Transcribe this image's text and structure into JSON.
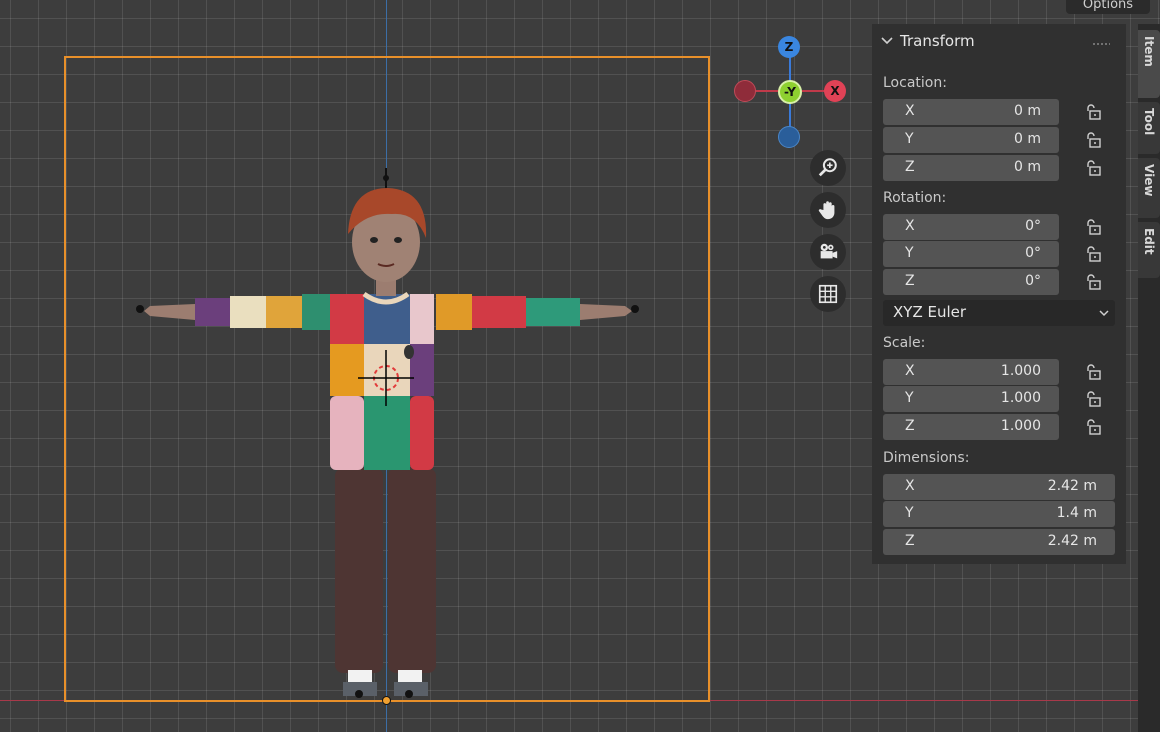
{
  "viewport": {
    "gizmo": {
      "z_label": "Z",
      "y_label": "-Y",
      "x_label": "X"
    }
  },
  "sidebar": {
    "options_label": "Options",
    "panel_title": "Transform",
    "location": {
      "label": "Location:",
      "x": {
        "axis": "X",
        "value": "0 m"
      },
      "y": {
        "axis": "Y",
        "value": "0 m"
      },
      "z": {
        "axis": "Z",
        "value": "0 m"
      }
    },
    "rotation": {
      "label": "Rotation:",
      "x": {
        "axis": "X",
        "value": "0°"
      },
      "y": {
        "axis": "Y",
        "value": "0°"
      },
      "z": {
        "axis": "Z",
        "value": "0°"
      },
      "mode": "XYZ Euler"
    },
    "scale": {
      "label": "Scale:",
      "x": {
        "axis": "X",
        "value": "1.000"
      },
      "y": {
        "axis": "Y",
        "value": "1.000"
      },
      "z": {
        "axis": "Z",
        "value": "1.000"
      }
    },
    "dimensions": {
      "label": "Dimensions:",
      "x": {
        "axis": "X",
        "value": "2.42 m"
      },
      "y": {
        "axis": "Y",
        "value": "1.4 m"
      },
      "z": {
        "axis": "Z",
        "value": "2.42 m"
      }
    },
    "tabs": [
      "Item",
      "Tool",
      "View",
      "Edit"
    ]
  }
}
